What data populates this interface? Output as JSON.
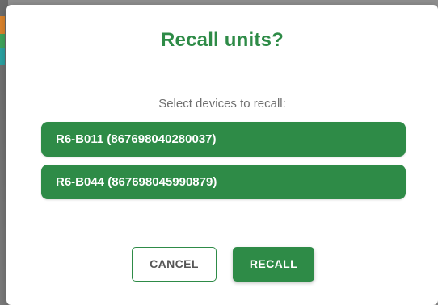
{
  "dialog": {
    "title": "Recall units?",
    "subtitle": "Select devices to recall:",
    "devices": [
      {
        "label": "R6-B011 (867698040280037)"
      },
      {
        "label": "R6-B044 (867698045990879)"
      }
    ],
    "actions": {
      "cancel_label": "CANCEL",
      "recall_label": "RECALL"
    }
  },
  "colors": {
    "accent": "#2e8b47",
    "overlay": "#8f8f8f",
    "subtitle": "#6f6f6f"
  }
}
